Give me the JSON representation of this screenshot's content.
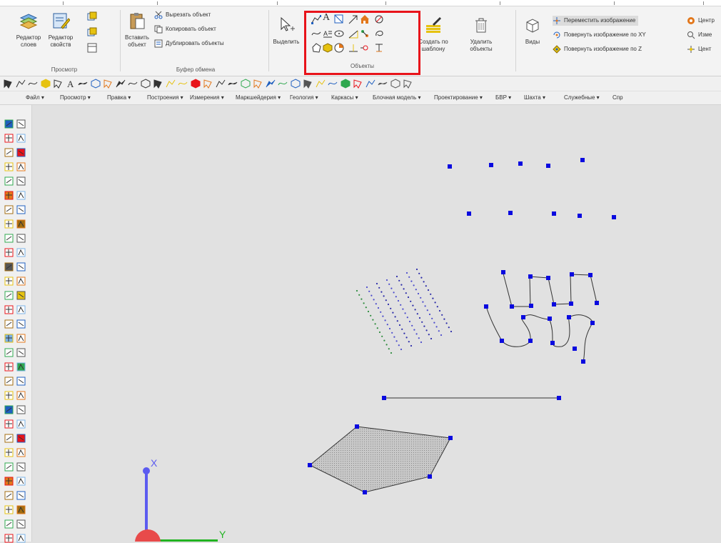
{
  "ribbon": {
    "view_group": {
      "label": "Просмотр",
      "layer_editor": "Редактор слоев",
      "property_editor": "Редактор свойств"
    },
    "clipboard_group": {
      "label": "Буфер обмена",
      "paste": "Вставить объект",
      "cut": "Вырезать объект",
      "copy": "Копировать объект",
      "duplicate": "Дублировать объекты"
    },
    "select_label": "Выделить",
    "objects_group": {
      "label": "Объекты",
      "create_from_template": "Создать по шаблону",
      "delete_objects": "Удалить объекты",
      "text_icon_glyph": "A"
    },
    "views_label": "Виды",
    "transform": {
      "move_image": "Переместить изображение",
      "rotate_xy": "Повернуть изображение по XY",
      "rotate_z": "Повернуть изображение по Z"
    },
    "extra": {
      "center1": "Центр",
      "measure": "Изме",
      "center2": "Цент"
    }
  },
  "quick_toolbar": {
    "text_glyph": "A"
  },
  "menu": [
    "Файл ▾",
    "Просмотр ▾",
    "Правка ▾",
    "Построения ▾",
    "Измерения ▾",
    "Маркшейдерия ▾",
    "Геология ▾",
    "Каркасы ▾",
    "Блочная модель ▾",
    "Проектирование ▾",
    "БВР ▾",
    "Шахта ▾",
    "Служебные ▾",
    "Спр"
  ],
  "axes": {
    "x_label": "X",
    "y_label": "Y",
    "x_color": "#5b5bf0",
    "y_color": "#21b321",
    "origin_color": "#e84a4a"
  },
  "colors": {
    "accent_highlight": "#e8131a",
    "node": "#0a0adf",
    "icon_blue": "#1f5fbf",
    "icon_orange": "#e2771b",
    "icon_yellow": "#e6c210"
  }
}
